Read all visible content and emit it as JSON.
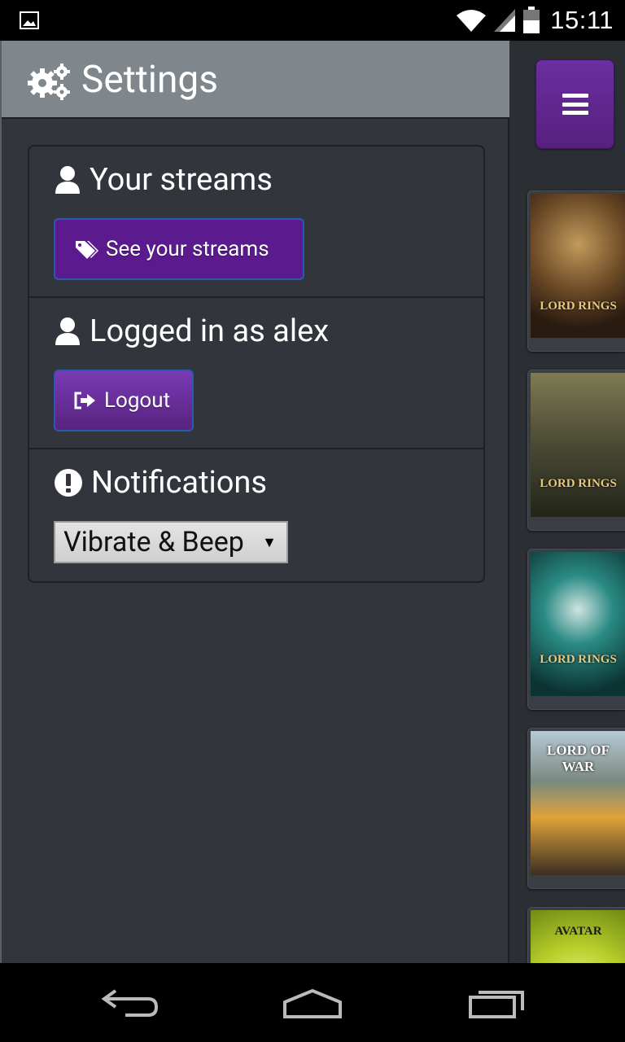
{
  "status_bar": {
    "time": "15:11",
    "left_icon": "image-icon",
    "icons": [
      "wifi-icon",
      "signal-icon",
      "battery-icon"
    ]
  },
  "settings": {
    "title": "Settings",
    "title_icon": "gears-icon",
    "sections": [
      {
        "heading": "Your streams",
        "icon": "user-icon",
        "button_label": "See your streams",
        "button_icon": "tags-icon"
      },
      {
        "heading": "Logged in as alex",
        "icon": "user-icon",
        "button_label": "Logout",
        "button_icon": "logout-icon"
      },
      {
        "heading": "Notifications",
        "icon": "exclamation-circle-icon",
        "select_value": "Vibrate & Beep"
      }
    ]
  },
  "content": {
    "menu_icon": "hamburger-icon",
    "posters": [
      {
        "title": "LORD RINGS",
        "colors": [
          "#8a6a3a",
          "#3b2a1a"
        ]
      },
      {
        "title": "LORD RINGS",
        "colors": [
          "#6a6a4a",
          "#2a2a1e"
        ]
      },
      {
        "title": "LORD RINGS",
        "colors": [
          "#1f7c78",
          "#0e3b3a"
        ]
      },
      {
        "title": "LORD OF WAR",
        "colors": [
          "#9bb5c9",
          "#3a3a2c"
        ]
      },
      {
        "title": "AVATAR",
        "colors": [
          "#d9e23a",
          "#8aa51a"
        ]
      }
    ]
  },
  "nav_bar": {
    "icons": [
      "back-icon",
      "home-icon",
      "recents-icon"
    ]
  },
  "colors": {
    "accent": "#5b1b8f",
    "panel": "#32363c",
    "header": "#7f878d"
  }
}
